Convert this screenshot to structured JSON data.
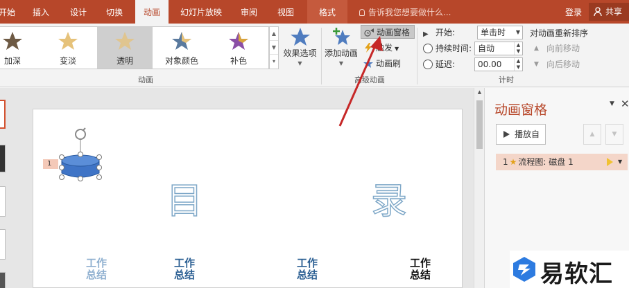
{
  "tabs": [
    {
      "label": "开始"
    },
    {
      "label": "插入"
    },
    {
      "label": "设计"
    },
    {
      "label": "切换"
    },
    {
      "label": "动画"
    },
    {
      "label": "幻灯片放映"
    },
    {
      "label": "审阅"
    },
    {
      "label": "视图"
    },
    {
      "label": "格式"
    }
  ],
  "tell_me_placeholder": "告诉我您想要做什么...",
  "login_label": "登录",
  "share_label": "共享",
  "gallery": {
    "items": [
      {
        "label": "加深",
        "color": "#6e5a44"
      },
      {
        "label": "变淡",
        "color": "#e6c27a"
      },
      {
        "label": "透明",
        "color": "#e6c27a"
      },
      {
        "label": "对象颜色",
        "color": "#5a7a9e"
      },
      {
        "label": "补色",
        "color": "#8b4fa6"
      }
    ],
    "selected": "透明"
  },
  "ribbon": {
    "effect_options": "效果选项",
    "group_animation": "动画",
    "add_animation": "添加动画",
    "animation_pane": "动画窗格",
    "trigger": "触发",
    "animation_painter": "动画刷",
    "group_advanced": "高级动画",
    "start_label": "开始:",
    "start_value": "单击时",
    "duration_label": "持续时间:",
    "duration_value": "自动",
    "delay_label": "延迟:",
    "delay_value": "00.00",
    "group_timing": "计时",
    "reorder_title": "对动画重新排序",
    "move_earlier": "向前移动",
    "move_later": "向后移动"
  },
  "slide": {
    "tag_number": "1",
    "title_left": "目",
    "title_right": "录",
    "small_text_line1": "工作",
    "small_text_line2": "总结"
  },
  "pane": {
    "title": "动画窗格",
    "play_from": "播放自",
    "item_number": "1",
    "item_text": "流程图: 磁盘 1"
  },
  "watermark": "易软汇",
  "colors": {
    "accent": "#b7472a",
    "selection": "#f4d6c9"
  }
}
